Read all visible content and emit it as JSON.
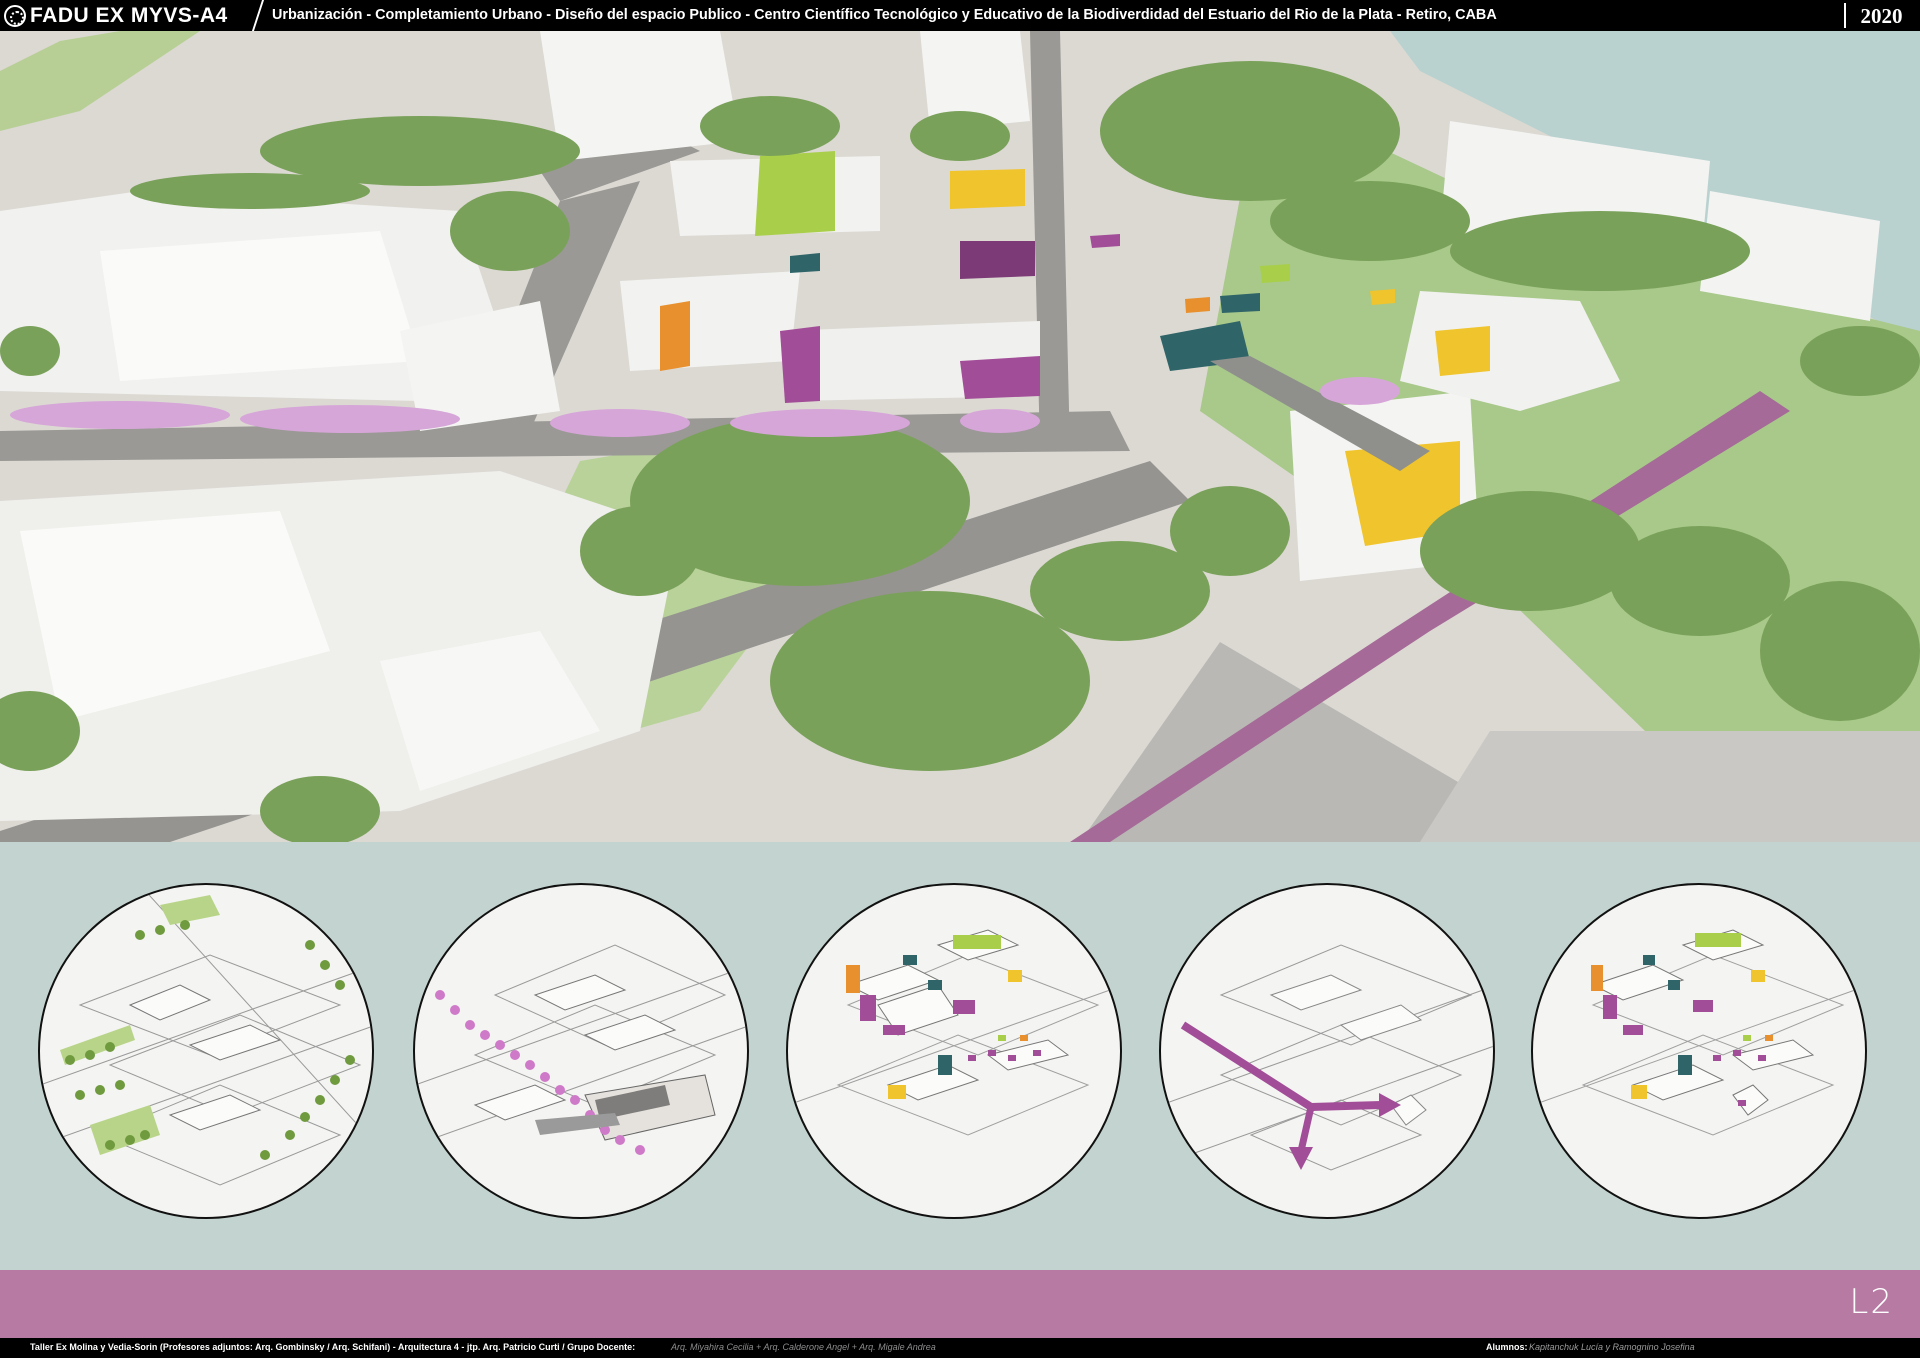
{
  "header": {
    "logo_text": "FADU EX MYVS-A4",
    "subtitle": "Urbanización - Completamiento Urbano - Diseño del espacio Publico - Centro Científico Tecnológico y Educativo de la Biodiverdidad del Estuario del Rio de la Plata   - Retiro, CABA",
    "year": "2020"
  },
  "aerial": {
    "icon": "aerial-render-image"
  },
  "diagrams": [
    {
      "icon": "green-spaces-diagram"
    },
    {
      "icon": "tree-lined-avenue-plaza-diagram"
    },
    {
      "icon": "colored-buildings-diagram"
    },
    {
      "icon": "pedestrian-route-arrow-diagram"
    },
    {
      "icon": "combined-proposal-diagram"
    }
  ],
  "band": {
    "sheet_label": "L2"
  },
  "footer": {
    "credits": "Taller Ex Molina y Vedia-Sorin (Profesores adjuntos:  Arq. Gombinsky / Arq. Schifani) - Arquitectura 4 - jtp. Arq. Patricio Curti / Grupo Docente:",
    "team": "Arq. Miyahira Cecilia  +  Arq. Calderone Angel  +  Arq. Migale Andrea",
    "students_label": "Alumnos:",
    "students": "Kapitanchuk Lucía  y  Ramognino Josefina"
  },
  "colors": {
    "strip": "#c3d3cf",
    "band": "#b67aa3",
    "lime": "#a9cf4a",
    "yellow": "#f0c42c",
    "orange": "#e8902e",
    "magenta": "#a24d97",
    "teal": "#2f6468",
    "trees": "#7aa15a",
    "blossom": "#d6a6d8"
  }
}
